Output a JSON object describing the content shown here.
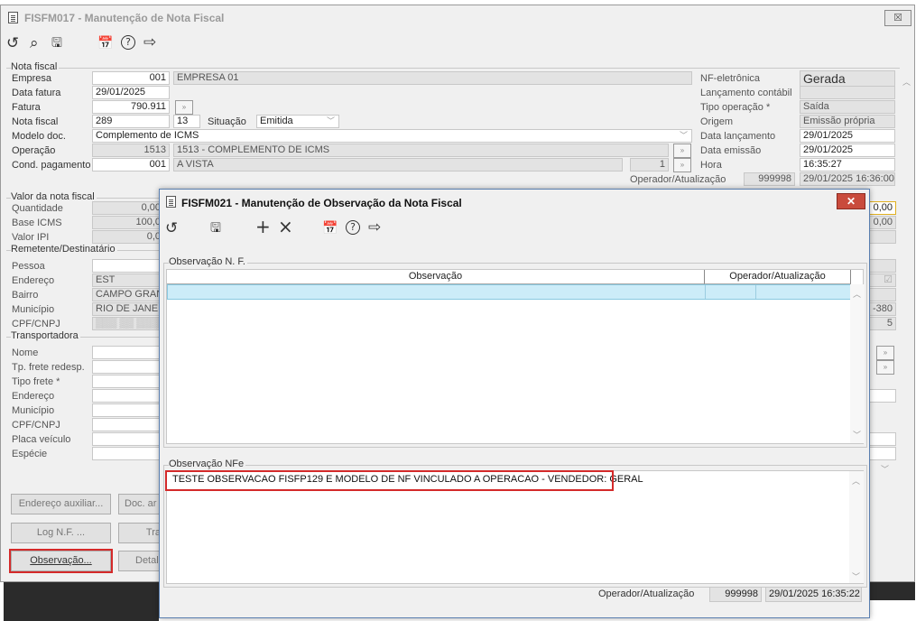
{
  "main": {
    "title": "FISFM017 - Manutenção de Nota Fiscal",
    "close_label": "☒",
    "toolbar": {
      "refresh": "↺",
      "search": "⌕",
      "save": "🖫",
      "calendar": "📅",
      "help": "?",
      "exit": "⇨"
    },
    "groups": {
      "nota_fiscal": "Nota fiscal",
      "valor": "Valor da nota fiscal",
      "remetente": "Remetente/Destinatário",
      "transportadora": "Transportadora"
    },
    "nota_fiscal": {
      "empresa_label": "Empresa",
      "empresa_code": "001",
      "empresa_name": "EMPRESA 01",
      "data_fatura_label": "Data fatura",
      "data_fatura": "29/01/2025",
      "fatura_label": "Fatura",
      "fatura": "790.911",
      "nota_fiscal_label": "Nota fiscal",
      "nota_fiscal": "289",
      "serie": "13",
      "situacao_label": "Situação",
      "situacao": "Emitida",
      "modelo_label": "Modelo doc.",
      "modelo": "Complemento de ICMS",
      "operacao_label": "Operação",
      "operacao_code": "1513",
      "operacao_desc": "1513 - COMPLEMENTO DE ICMS",
      "cond_label": "Cond. pagamento",
      "cond_code": "001",
      "cond_desc": "A VISTA",
      "cond_parcelas": "1",
      "nfe_label": "NF-eletrônica",
      "nfe": "Gerada",
      "lanc_contabil_label": "Lançamento contábil",
      "lanc_contabil": "",
      "tipo_op_label": "Tipo operação *",
      "tipo_op": "Saída",
      "origem_label": "Origem",
      "origem": "Emissão própria",
      "data_lanc_label": "Data lançamento",
      "data_lanc": "29/01/2025",
      "data_emissao_label": "Data emissão",
      "data_emissao": "29/01/2025",
      "hora_label": "Hora",
      "hora": "16:35:27",
      "operador_label": "Operador/Atualização",
      "operador": "999998",
      "atualizacao": "29/01/2025 16:36:00"
    },
    "valor": {
      "quantidade_label": "Quantidade",
      "quantidade": "0,00",
      "base_icms_label": "Base ICMS",
      "base_icms": "100,0",
      "valor_ipi_label": "Valor IPI",
      "valor_ipi": "0,0",
      "right_val1": "0,00",
      "right_val2": "0,00"
    },
    "remetente": {
      "pessoa_label": "Pessoa",
      "pessoa": "",
      "endereco_label": "Endereço",
      "endereco": "EST",
      "bairro_label": "Bairro",
      "bairro": "CAMPO GRAN",
      "municipio_label": "Município",
      "municipio": "RIO DE JANEIR",
      "cpf_label": "CPF/CNPJ",
      "cpf": "▒▒▒ ▒▒ ▒▒▒▒▒▒",
      "right_cep": "-380",
      "right_num": "5"
    },
    "transportadora": {
      "nome_label": "Nome",
      "tp_frete_redesp_label": "Tp. frete redesp.",
      "tipo_frete_label": "Tipo frete *",
      "endereco_label": "Endereço",
      "municipio_label": "Município",
      "cpf_label": "CPF/CNPJ",
      "placa_label": "Placa veículo",
      "especie_label": "Espécie"
    },
    "buttons": {
      "endereco_auxiliar": "Endereço auxiliar...",
      "doc_ar": "Doc. ar",
      "log_nf": "Log N.F. ...",
      "tra": "Tra",
      "observacao": "Observação...",
      "detal": "Detal"
    }
  },
  "dialog": {
    "title": "FISFM021 - Manutenção de Observação da Nota Fiscal",
    "close_label": "✕",
    "toolbar": {
      "refresh": "↺",
      "save": "🖫",
      "add": "+",
      "delete": "×",
      "calendar": "📅",
      "help": "?",
      "exit": "⇨"
    },
    "obs_nf_group": "Observação N. F.",
    "grid_headers": {
      "observacao": "Observação",
      "operador": "Operador/Atualização"
    },
    "obs_nfe_group": "Observação NFe",
    "obs_nfe_text": "TESTE OBSERVACAO FISFP129 E MODELO DE NF VINCULADO A OPERACAO - VENDEDOR: GERAL",
    "footer_label": "Operador/Atualização",
    "footer_operador": "999998",
    "footer_data": "29/01/2025 16:35:22"
  }
}
